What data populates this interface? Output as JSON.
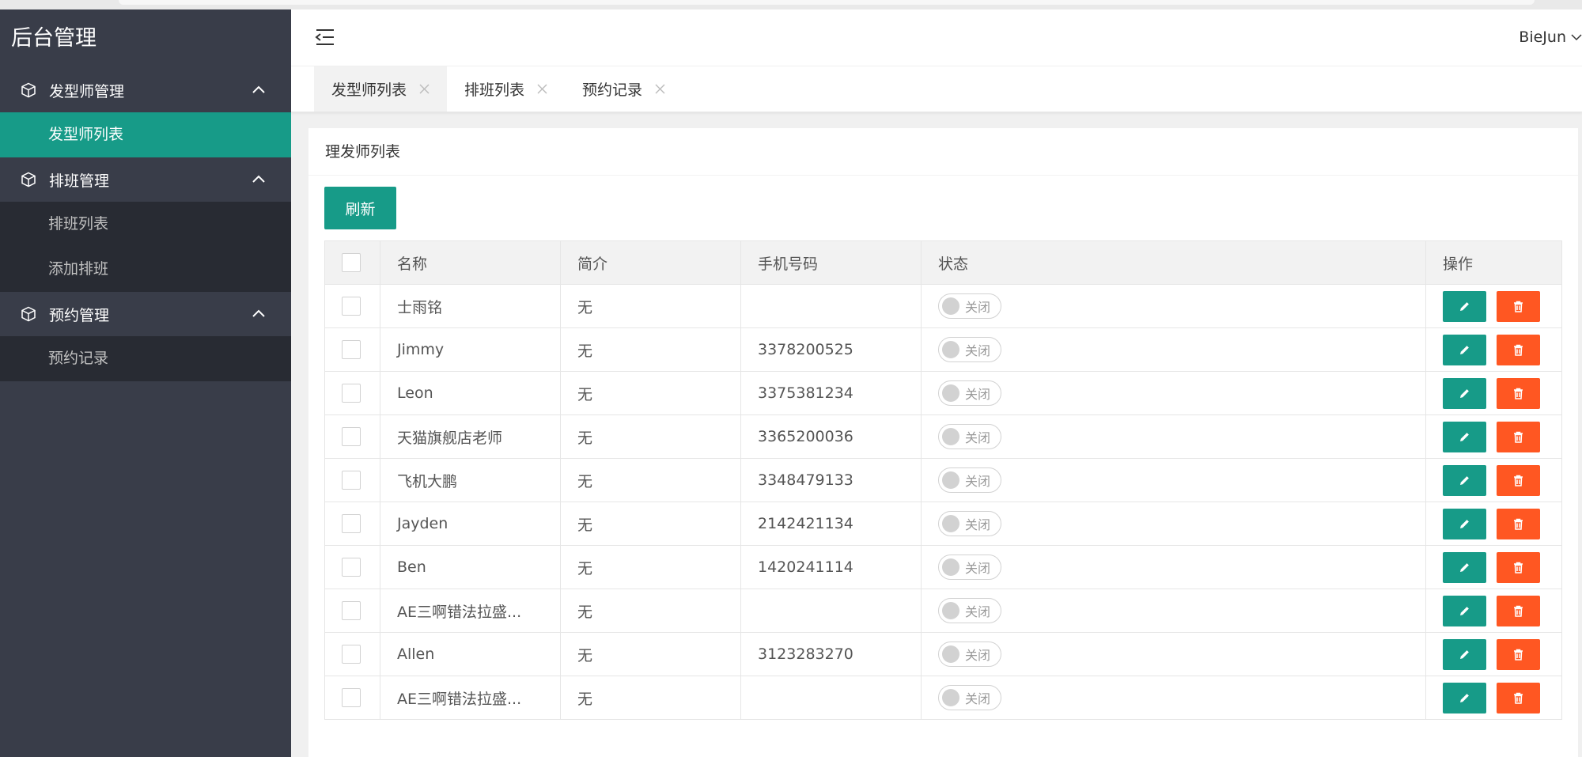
{
  "sidebar": {
    "logo": "后台管理",
    "groups": [
      {
        "title": "发型师管理",
        "items": [
          {
            "label": "发型师列表",
            "active": true
          }
        ]
      },
      {
        "title": "排班管理",
        "items": [
          {
            "label": "排班列表"
          },
          {
            "label": "添加排班"
          }
        ]
      },
      {
        "title": "预约管理",
        "items": [
          {
            "label": "预约记录"
          }
        ]
      }
    ]
  },
  "header": {
    "user": "BieJun"
  },
  "tabs": [
    {
      "label": "发型师列表",
      "active": true
    },
    {
      "label": "排班列表"
    },
    {
      "label": "预约记录"
    }
  ],
  "card": {
    "title": "理发师列表",
    "refresh_label": "刷新"
  },
  "table": {
    "headers": [
      "名称",
      "简介",
      "手机号码",
      "状态",
      "操作"
    ],
    "rows": [
      {
        "name": "士雨铭",
        "intro": "无",
        "phone": "",
        "status": "关闭"
      },
      {
        "name": "Jimmy",
        "intro": "无",
        "phone": "3378200525",
        "status": "关闭"
      },
      {
        "name": "Leon",
        "intro": "无",
        "phone": "3375381234",
        "status": "关闭"
      },
      {
        "name": "天猫旗舰店老师",
        "intro": "无",
        "phone": "3365200036",
        "status": "关闭"
      },
      {
        "name": "飞机大鹏",
        "intro": "无",
        "phone": "3348479133",
        "status": "关闭"
      },
      {
        "name": "Jayden",
        "intro": "无",
        "phone": "2142421134",
        "status": "关闭"
      },
      {
        "name": "Ben",
        "intro": "无",
        "phone": "1420241114",
        "status": "关闭"
      },
      {
        "name": "AE三啊错法拉盛...",
        "intro": "无",
        "phone": "",
        "status": "关闭"
      },
      {
        "name": "Allen",
        "intro": "无",
        "phone": "3123283270",
        "status": "关闭"
      },
      {
        "name": "AE三啊错法拉盛...",
        "intro": "无",
        "phone": "",
        "status": "关闭"
      }
    ]
  },
  "colors": {
    "accent": "#179b88",
    "danger": "#ff5722",
    "sidebar": "#393d49",
    "sidebar_sub": "#282b33"
  }
}
